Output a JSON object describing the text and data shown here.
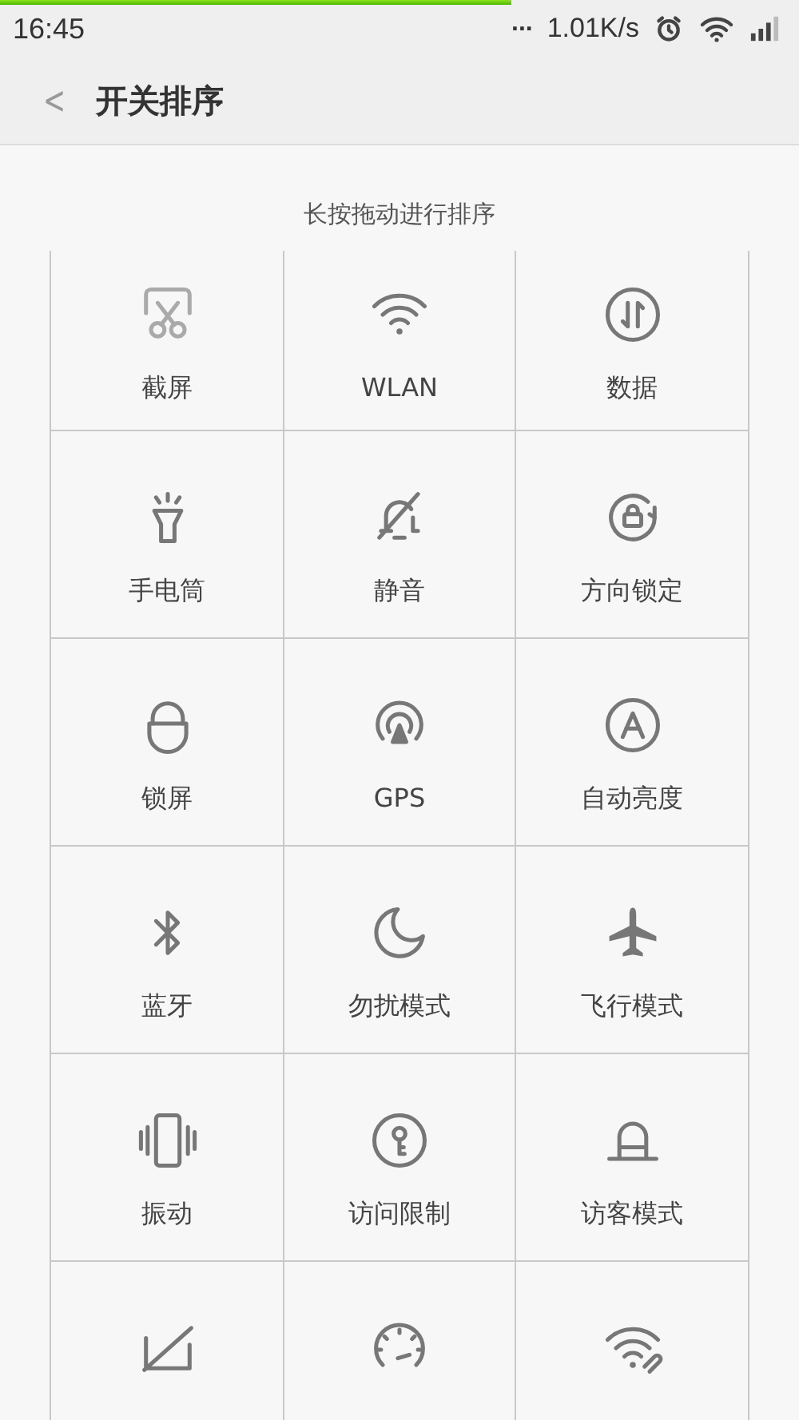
{
  "status_bar": {
    "time": "16:45",
    "more": "...",
    "speed": "1.01K/s"
  },
  "loading_bar": {
    "level": 0.64
  },
  "header": {
    "back": "<",
    "title": "开关排序"
  },
  "hint": "长按拖动进行排序",
  "toggles": [
    {
      "kind": "labeled",
      "label": "截屏"
    },
    {
      "kind": "labeled",
      "label": "WLAN"
    },
    {
      "kind": "labeled",
      "label": "数据"
    },
    {
      "kind": "labeled",
      "label": "手电筒"
    },
    {
      "kind": "labeled",
      "label": "静音"
    },
    {
      "kind": "labeled",
      "label": "方向锁定"
    },
    {
      "kind": "labeled",
      "label": "锁屏"
    },
    {
      "kind": "labeled",
      "label": "GPS"
    },
    {
      "kind": "labeled",
      "label": "自动亮度"
    },
    {
      "kind": "labeled",
      "label": "蓝牙"
    },
    {
      "kind": "labeled",
      "label": "勿扰模式"
    },
    {
      "kind": "labeled",
      "label": "飞行模式"
    },
    {
      "kind": "labeled",
      "label": "振动"
    },
    {
      "kind": "labeled",
      "label": "访问限制"
    },
    {
      "kind": "labeled",
      "label": "访客模式"
    },
    {
      "kind": "cut_off"
    },
    {
      "kind": "cut_off"
    },
    {
      "kind": "cut_off"
    }
  ]
}
